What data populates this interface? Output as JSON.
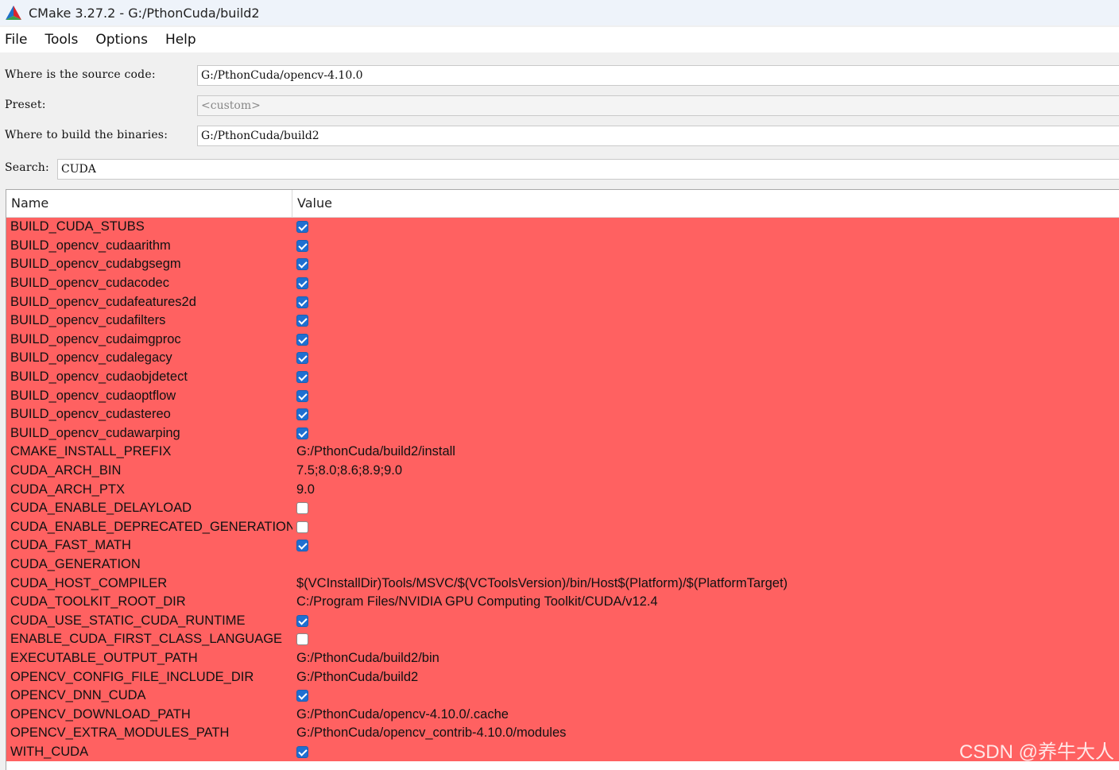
{
  "window": {
    "title": "CMake 3.27.2 - G:/PthonCuda/build2"
  },
  "menu": {
    "file": "File",
    "tools": "Tools",
    "options": "Options",
    "help": "Help"
  },
  "form": {
    "source_label": "Where is the source code:",
    "source_value": "G:/PthonCuda/opencv-4.10.0",
    "preset_label": "Preset:",
    "preset_value": "<custom>",
    "build_label": "Where to build the binaries:",
    "build_value": "G:/PthonCuda/build2",
    "search_label": "Search:",
    "search_value": "CUDA"
  },
  "table": {
    "headers": {
      "name": "Name",
      "value": "Value"
    },
    "row_color": "#ff6161",
    "rows": [
      {
        "name": "BUILD_CUDA_STUBS",
        "type": "bool",
        "checked": true
      },
      {
        "name": "BUILD_opencv_cudaarithm",
        "type": "bool",
        "checked": true
      },
      {
        "name": "BUILD_opencv_cudabgsegm",
        "type": "bool",
        "checked": true
      },
      {
        "name": "BUILD_opencv_cudacodec",
        "type": "bool",
        "checked": true
      },
      {
        "name": "BUILD_opencv_cudafeatures2d",
        "type": "bool",
        "checked": true
      },
      {
        "name": "BUILD_opencv_cudafilters",
        "type": "bool",
        "checked": true
      },
      {
        "name": "BUILD_opencv_cudaimgproc",
        "type": "bool",
        "checked": true
      },
      {
        "name": "BUILD_opencv_cudalegacy",
        "type": "bool",
        "checked": true
      },
      {
        "name": "BUILD_opencv_cudaobjdetect",
        "type": "bool",
        "checked": true
      },
      {
        "name": "BUILD_opencv_cudaoptflow",
        "type": "bool",
        "checked": true
      },
      {
        "name": "BUILD_opencv_cudastereo",
        "type": "bool",
        "checked": true
      },
      {
        "name": "BUILD_opencv_cudawarping",
        "type": "bool",
        "checked": true
      },
      {
        "name": "CMAKE_INSTALL_PREFIX",
        "type": "text",
        "value": "G:/PthonCuda/build2/install"
      },
      {
        "name": "CUDA_ARCH_BIN",
        "type": "text",
        "value": "7.5;8.0;8.6;8.9;9.0"
      },
      {
        "name": "CUDA_ARCH_PTX",
        "type": "text",
        "value": "9.0"
      },
      {
        "name": "CUDA_ENABLE_DELAYLOAD",
        "type": "bool",
        "checked": false
      },
      {
        "name": "CUDA_ENABLE_DEPRECATED_GENERATION",
        "type": "bool",
        "checked": false
      },
      {
        "name": "CUDA_FAST_MATH",
        "type": "bool",
        "checked": true
      },
      {
        "name": "CUDA_GENERATION",
        "type": "text",
        "value": ""
      },
      {
        "name": "CUDA_HOST_COMPILER",
        "type": "text",
        "value": "$(VCInstallDir)Tools/MSVC/$(VCToolsVersion)/bin/Host$(Platform)/$(PlatformTarget)"
      },
      {
        "name": "CUDA_TOOLKIT_ROOT_DIR",
        "type": "text",
        "value": "C:/Program Files/NVIDIA GPU Computing Toolkit/CUDA/v12.4"
      },
      {
        "name": "CUDA_USE_STATIC_CUDA_RUNTIME",
        "type": "bool",
        "checked": true
      },
      {
        "name": "ENABLE_CUDA_FIRST_CLASS_LANGUAGE",
        "type": "bool",
        "checked": false
      },
      {
        "name": "EXECUTABLE_OUTPUT_PATH",
        "type": "text",
        "value": "G:/PthonCuda/build2/bin"
      },
      {
        "name": "OPENCV_CONFIG_FILE_INCLUDE_DIR",
        "type": "text",
        "value": "G:/PthonCuda/build2"
      },
      {
        "name": "OPENCV_DNN_CUDA",
        "type": "bool",
        "checked": true
      },
      {
        "name": "OPENCV_DOWNLOAD_PATH",
        "type": "text",
        "value": "G:/PthonCuda/opencv-4.10.0/.cache"
      },
      {
        "name": "OPENCV_EXTRA_MODULES_PATH",
        "type": "text",
        "value": "G:/PthonCuda/opencv_contrib-4.10.0/modules"
      },
      {
        "name": "WITH_CUDA",
        "type": "bool",
        "checked": true
      }
    ]
  },
  "watermark": "CSDN @养牛大人"
}
